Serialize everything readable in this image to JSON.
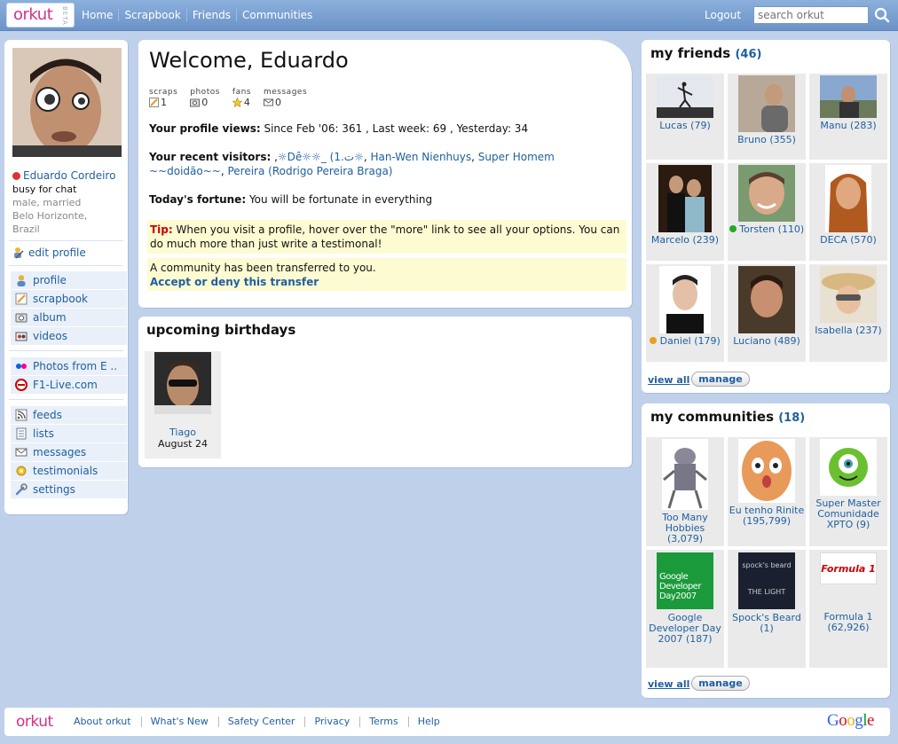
{
  "topbar": {
    "logo": "orkut",
    "beta": "BETA",
    "nav": [
      "Home",
      "Scrapbook",
      "Friends",
      "Communities"
    ],
    "logout": "Logout",
    "search_placeholder": "search orkut"
  },
  "profile": {
    "name": "Eduardo Cordeiro",
    "status": "busy for chat",
    "line1": "male, married",
    "line2": "Belo Horizonte,",
    "line3": "Brazil",
    "edit": "edit profile"
  },
  "leftnav": {
    "group1": [
      {
        "label": "profile",
        "icon": "user-icon"
      },
      {
        "label": "scrapbook",
        "icon": "scrapbook-icon"
      },
      {
        "label": "album",
        "icon": "camera-icon"
      },
      {
        "label": "videos",
        "icon": "video-icon"
      }
    ],
    "group2": [
      {
        "label": "Photos from E ..",
        "icon": "flickr-icon"
      },
      {
        "label": "F1-Live.com",
        "icon": "f1-icon"
      }
    ],
    "group3": [
      {
        "label": "feeds",
        "icon": "rss-icon"
      },
      {
        "label": "lists",
        "icon": "list-icon"
      },
      {
        "label": "messages",
        "icon": "envelope-icon"
      },
      {
        "label": "testimonials",
        "icon": "badge-icon"
      },
      {
        "label": "settings",
        "icon": "wrench-icon"
      }
    ]
  },
  "main": {
    "welcome": "Welcome, Eduardo",
    "stats": [
      {
        "label": "scraps",
        "value": "1"
      },
      {
        "label": "photos",
        "value": "0"
      },
      {
        "label": "fans",
        "value": "4"
      },
      {
        "label": "messages",
        "value": "0"
      }
    ],
    "views_label": "Your profile views:",
    "views_text": " Since Feb '06: 361 , Last week: 69 , Yesterday: 34",
    "visitors_label": "Your recent visitors:",
    "visitors_pre": " ,",
    "visitors": [
      "☼Dê☼☼_ (1.ت☼",
      "Han-Wen Nienhuys",
      "Super Homem ~~doidão~~",
      "Pereira (Rodrigo Pereira Braga)"
    ],
    "fortune_label": "Today's fortune:",
    "fortune_text": " You will be fortunate in everything",
    "tip_label": "Tip:",
    "tip_text": " When you visit a profile, hover over the \"more\" link to see all your options. You can do much more than just write a testimonal!",
    "transfer_text": "A community has been transferred to you.",
    "transfer_link": "Accept or deny this transfer"
  },
  "birthdays": {
    "title": "upcoming birthdays",
    "items": [
      {
        "name": "Tiago",
        "date": "August 24"
      }
    ]
  },
  "friends": {
    "title": "my friends",
    "count": "(46)",
    "view_all": "view all",
    "manage": "manage",
    "items": [
      {
        "name": "Lucas (79)",
        "online": ""
      },
      {
        "name": "Bruno (355)",
        "online": ""
      },
      {
        "name": "Manu (283)",
        "online": ""
      },
      {
        "name": "Marcelo (239)",
        "online": ""
      },
      {
        "name": "Torsten (110)",
        "online": "#2a2"
      },
      {
        "name": "DECA (570)",
        "online": ""
      },
      {
        "name": "Daniel (179)",
        "online": "#e8a020"
      },
      {
        "name": "Luciano (489)",
        "online": ""
      },
      {
        "name": "Isabella (237)",
        "online": ""
      }
    ]
  },
  "communities": {
    "title": "my communities",
    "count": "(18)",
    "view_all": "view all",
    "manage": "manage",
    "items": [
      {
        "name": "Too Many Hobbies (3,079)",
        "img_text": ""
      },
      {
        "name": "Eu tenho Rinite (195,799)",
        "img_text": ""
      },
      {
        "name": "Super Master Comunidade XPTO (9)",
        "img_text": ""
      },
      {
        "name": "Google Developer Day 2007 (187)",
        "img_text": "Google Developer Day2007"
      },
      {
        "name": "Spock's Beard (1)",
        "img_text": "spock's beard THE LIGHT"
      },
      {
        "name": "Formula 1 (62,926)",
        "img_text": "Formula 1"
      }
    ]
  },
  "footer": {
    "logo": "orkut",
    "links": [
      "About orkut",
      "What's New",
      "Safety Center",
      "Privacy",
      "Terms",
      "Help"
    ],
    "google": "Google"
  }
}
